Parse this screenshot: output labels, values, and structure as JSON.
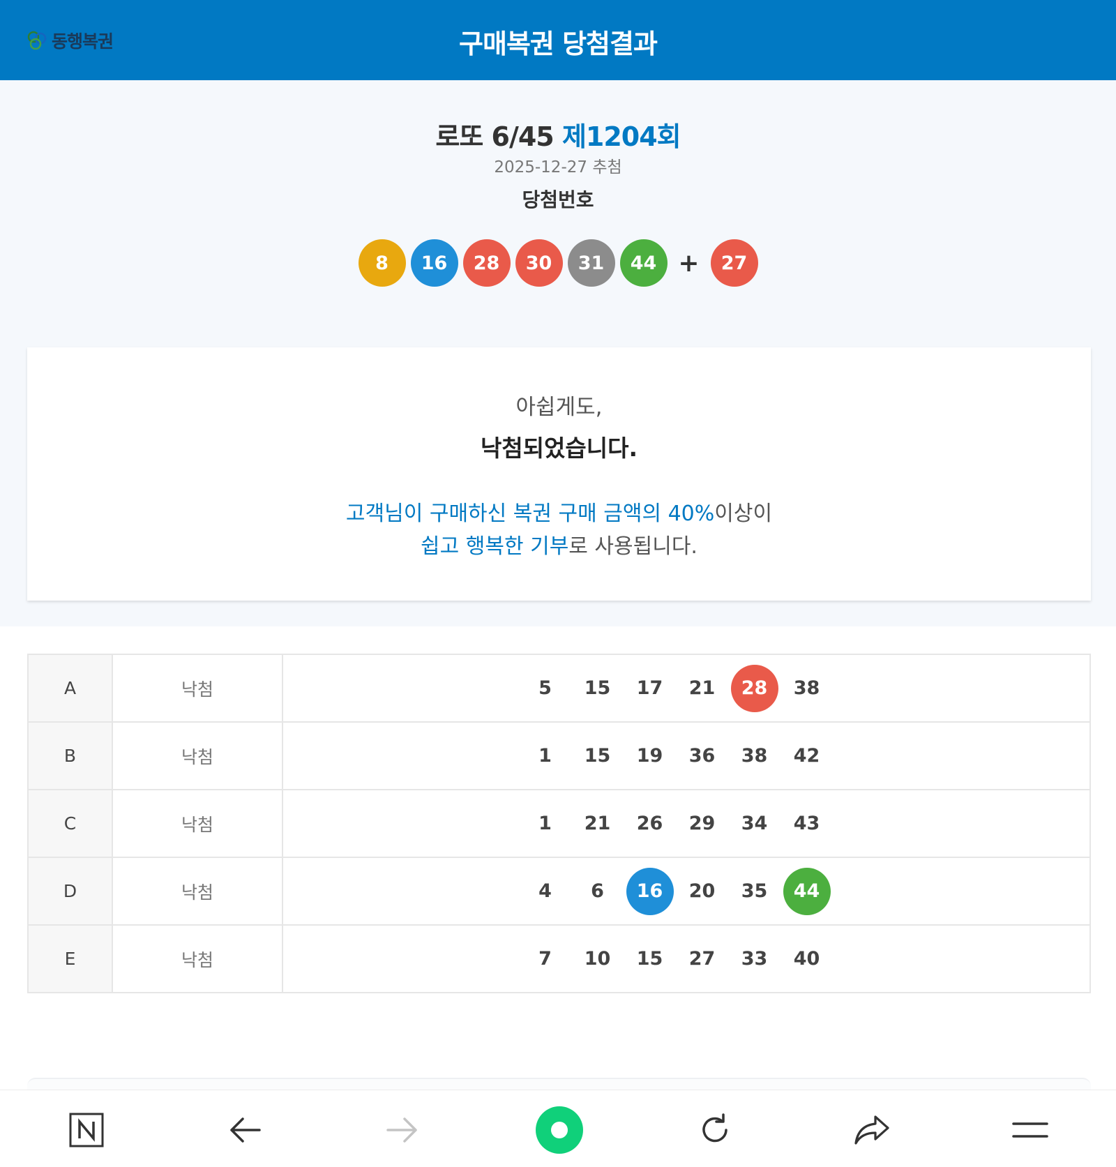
{
  "header": {
    "logo_text": "동행복권",
    "title": "구매복권 당첨결과"
  },
  "draw": {
    "game_name": "로또 6/45",
    "round": "제1204회",
    "date": "2025-12-27 추첨",
    "winning_label": "당첨번호",
    "numbers": [
      {
        "value": "8",
        "color": "#e8a80f"
      },
      {
        "value": "16",
        "color": "#1f8fd8"
      },
      {
        "value": "28",
        "color": "#e95a4a"
      },
      {
        "value": "30",
        "color": "#e95a4a"
      },
      {
        "value": "31",
        "color": "#8c8c8c"
      },
      {
        "value": "44",
        "color": "#4caf3f"
      }
    ],
    "plus": "+",
    "bonus": {
      "value": "27",
      "color": "#e95a4a"
    }
  },
  "result": {
    "line1": "아쉽게도,",
    "line2": "낙첨되었습니다.",
    "donate_line1_blue": "고객님이 구매하신 복권 구매 금액의 40%",
    "donate_line1_rest": "이상이",
    "donate_line2_blue": "쉽고 행복한 기부",
    "donate_line2_rest": "로 사용됩니다."
  },
  "games": [
    {
      "letter": "A",
      "status": "낙첨",
      "numbers": [
        {
          "value": "5"
        },
        {
          "value": "15"
        },
        {
          "value": "17"
        },
        {
          "value": "21"
        },
        {
          "value": "28",
          "hit": true,
          "color": "#e95a4a"
        },
        {
          "value": "38"
        }
      ]
    },
    {
      "letter": "B",
      "status": "낙첨",
      "numbers": [
        {
          "value": "1"
        },
        {
          "value": "15"
        },
        {
          "value": "19"
        },
        {
          "value": "36"
        },
        {
          "value": "38"
        },
        {
          "value": "42"
        }
      ]
    },
    {
      "letter": "C",
      "status": "낙첨",
      "numbers": [
        {
          "value": "1"
        },
        {
          "value": "21"
        },
        {
          "value": "26"
        },
        {
          "value": "29"
        },
        {
          "value": "34"
        },
        {
          "value": "43"
        }
      ]
    },
    {
      "letter": "D",
      "status": "낙첨",
      "numbers": [
        {
          "value": "4"
        },
        {
          "value": "6"
        },
        {
          "value": "16",
          "hit": true,
          "color": "#1f8fd8"
        },
        {
          "value": "20"
        },
        {
          "value": "35"
        },
        {
          "value": "44",
          "hit": true,
          "color": "#4caf3f"
        }
      ]
    },
    {
      "letter": "E",
      "status": "낙첨",
      "numbers": [
        {
          "value": "7"
        },
        {
          "value": "10"
        },
        {
          "value": "15"
        },
        {
          "value": "27"
        },
        {
          "value": "33"
        },
        {
          "value": "40"
        }
      ]
    }
  ],
  "navbar": {
    "icons": [
      "naver-n-icon",
      "back-arrow-icon",
      "forward-arrow-icon",
      "green-dot-icon",
      "refresh-icon",
      "share-icon",
      "menu-icon"
    ]
  },
  "colors": {
    "header_bg": "#0179c3",
    "accent": "#0179c3"
  }
}
